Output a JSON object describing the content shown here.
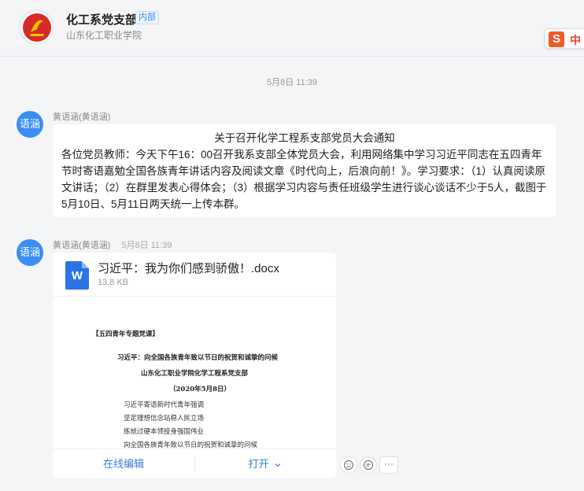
{
  "header": {
    "group_name": "化工系党支部",
    "badge": "内部",
    "org": "山东化工职业学院"
  },
  "ime": {
    "logo": "S",
    "mode": "中"
  },
  "timestamp": "5月8日 11:39",
  "messages": [
    {
      "avatar": "语涵",
      "sender": "黄语涵(黄语涵)",
      "title": "关于召开化学工程系支部党员大会通知",
      "body": "各位党员教师：今天下午16：00召开我系支部全体党员大会，利用网络集中学习习近平同志在五四青年节时寄语嘉勉全国各族青年讲话内容及阅读文章《时代向上，后浪向前！》。学习要求：（1）认真阅读原文讲话；（2）在群里发表心得体会；（3）根据学习内容与责任班级学生进行谈心谈话不少于5人，截图于5月10日、5月11日两天统一上传本群。"
    },
    {
      "avatar": "语涵",
      "sender": "黄语涵(黄语涵)",
      "time": "5月8日 11:39",
      "file": {
        "icon": "W",
        "name": "习近平：我为你们感到骄傲！.docx",
        "size": "13.8 KB",
        "preview": {
          "tag": "【五四青年专题党课】",
          "title": "习近平：向全国各族青年致以节日的祝贺和诚挚的问候",
          "org": "山东化工职业学院化学工程系党支部",
          "date": "（2020年5月8日）",
          "lines": [
            "习近平寄语新时代青年强调",
            "坚定理想信念站稳人民立场",
            "练就过硬本领投身强国伟业",
            "向全国各族青年致以节日的祝贺和诚挚的问候"
          ]
        },
        "actions": {
          "edit": "在线编辑",
          "open": "打开"
        }
      },
      "reactions": [
        "emoji-icon",
        "reply-icon",
        "more-icon"
      ]
    }
  ]
}
